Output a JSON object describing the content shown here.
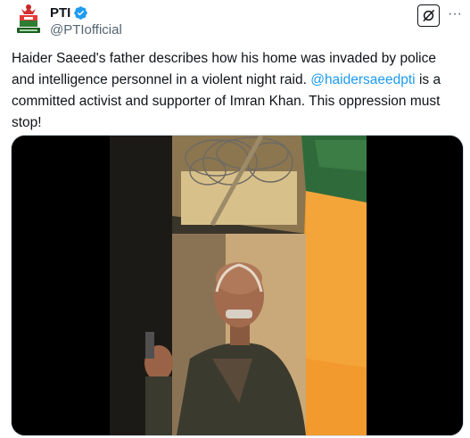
{
  "post": {
    "author_name": "PTI",
    "author_handle": "@PTIofficial",
    "verified": true,
    "text_before_mention": "Haider Saeed's father describes how his home was invaded by police and intelligence personnel in a violent night raid. ",
    "mention": "@haidersaeedpti",
    "text_after_mention": " is a committed activist and supporter of Imran Khan. This oppression must stop!",
    "more_label": "···"
  },
  "icons": {
    "avatar": "pti-logo-icon",
    "verified": "verified-badge-icon",
    "grok": "grok-icon",
    "more": "more-options-icon"
  },
  "colors": {
    "link": "#1d9bf0",
    "verified": "#1d9bf0",
    "text": "#0f1419",
    "muted": "#536471"
  }
}
